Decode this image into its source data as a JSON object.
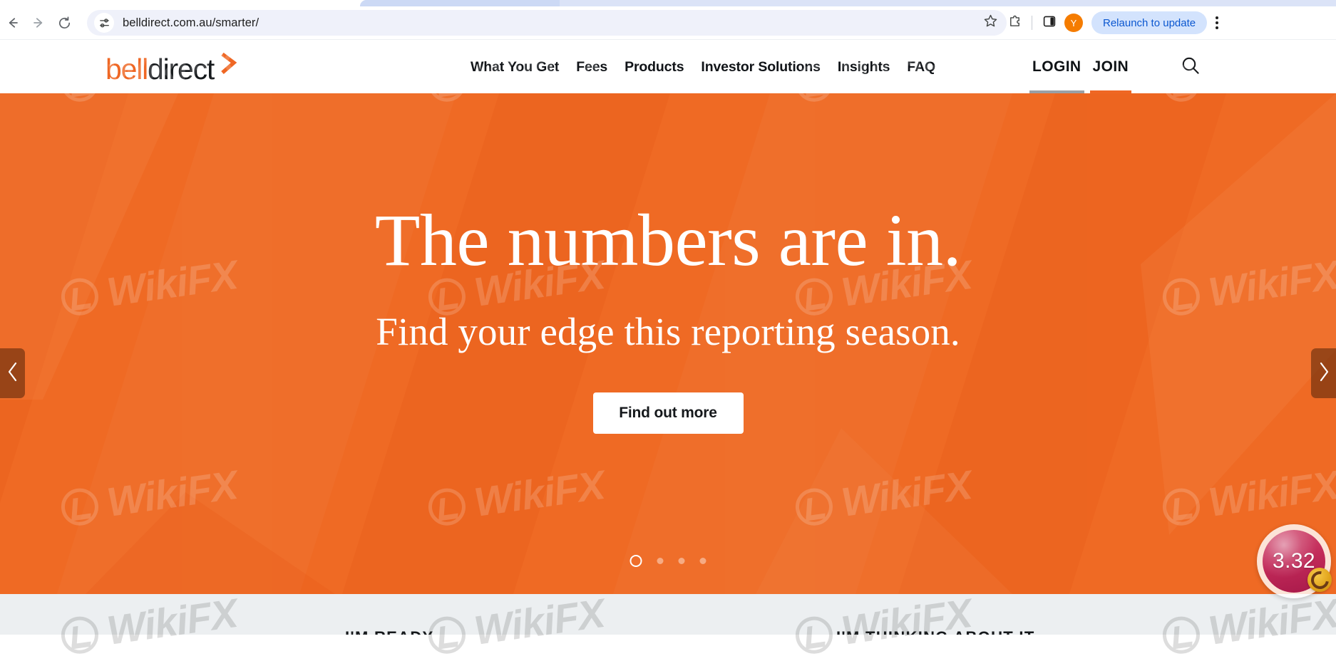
{
  "browser": {
    "url": "belldirect.com.au/smarter/",
    "back_icon": "back-arrow-icon",
    "forward_icon": "forward-arrow-icon",
    "reload_icon": "reload-icon",
    "site_info_icon": "site-settings-icon",
    "bookmark_icon": "star-icon",
    "extensions_icon": "extensions-puzzle-icon",
    "side_panel_icon": "side-panel-icon",
    "profile_initial": "Y",
    "relaunch_label": "Relaunch to update",
    "menu_icon": "three-dot-menu-icon"
  },
  "site_header": {
    "logo": {
      "part1": "bell",
      "part2": "direct",
      "chevron_icon": "chevron-right-icon",
      "color_primary": "#ef6724",
      "color_secondary": "#16191c"
    },
    "nav": [
      {
        "label": "What You Get"
      },
      {
        "label": "Fees"
      },
      {
        "label": "Products"
      },
      {
        "label": "Investor Solutions"
      },
      {
        "label": "Insights"
      },
      {
        "label": "FAQ"
      }
    ],
    "auth": {
      "login_label": "LOGIN",
      "login_underline_color": "#9aa0a6",
      "join_label": "JOIN",
      "join_underline_color": "#ef6724"
    },
    "search_icon": "search-icon"
  },
  "hero": {
    "background_color": "#ef6a24",
    "title": "The numbers are in.",
    "subtitle": "Find your edge this reporting season.",
    "cta_label": "Find out more",
    "prev_icon": "chevron-left-icon",
    "next_icon": "chevron-right-icon",
    "carousel": {
      "total": 4,
      "active_index": 0
    }
  },
  "below_fold": {
    "left_label": "I'M READY",
    "right_label": "I'M THINKING ABOUT IT"
  },
  "overlay": {
    "score_value": "3.32",
    "score_color": "#c22a59",
    "watermark_text": "WikiFX",
    "watermark_logo_icon": "wikifx-logo-icon"
  }
}
